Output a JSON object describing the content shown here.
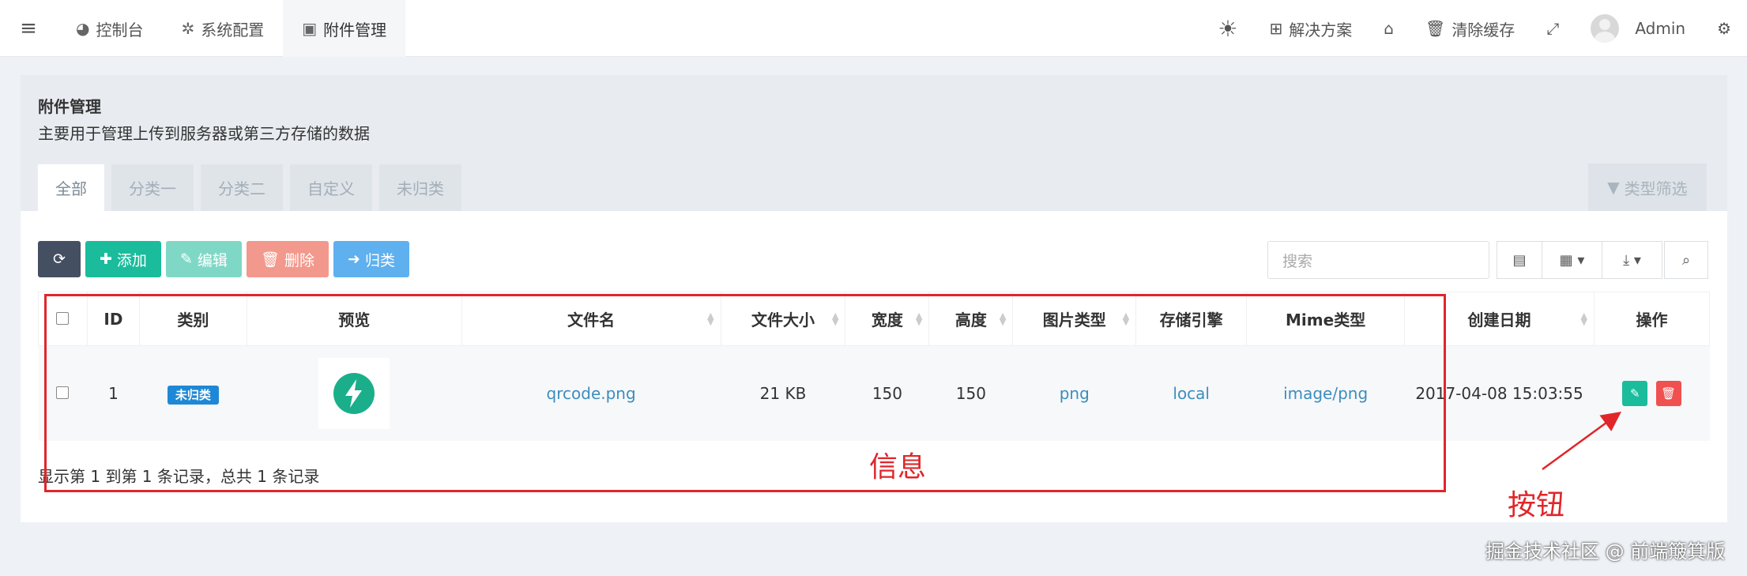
{
  "nav": {
    "items": [
      {
        "label": "控制台",
        "icon": "dashboard-icon"
      },
      {
        "label": "系统配置",
        "icon": "gear-icon"
      },
      {
        "label": "附件管理",
        "icon": "image-icon"
      }
    ],
    "right": {
      "solution": "解决方案",
      "clear_cache": "清除缓存",
      "user": "Admin"
    }
  },
  "panel": {
    "title": "附件管理",
    "description": "主要用于管理上传到服务器或第三方存储的数据",
    "tabs": [
      "全部",
      "分类一",
      "分类二",
      "自定义",
      "未归类"
    ],
    "filter_label": "类型筛选"
  },
  "toolbar": {
    "add": "添加",
    "edit": "编辑",
    "delete": "删除",
    "classify": "归类",
    "search_placeholder": "搜索"
  },
  "table": {
    "columns": [
      "ID",
      "类别",
      "预览",
      "文件名",
      "文件大小",
      "宽度",
      "高度",
      "图片类型",
      "存储引擎",
      "Mime类型",
      "创建日期",
      "操作"
    ],
    "rows": [
      {
        "id": "1",
        "category": "未归类",
        "filename": "qrcode.png",
        "filesize": "21 KB",
        "width": "150",
        "height": "150",
        "imagetype": "png",
        "storage": "local",
        "mime": "image/png",
        "created": "2017-04-08 15:03:55"
      }
    ]
  },
  "pagination_info": "显示第 1 到第 1 条记录，总共 1 条记录",
  "annotations": {
    "info": "信息",
    "buttons": "按钮"
  },
  "watermark": "掘金技术社区 @ 前端簸箕版",
  "colors": {
    "primary": "#1abc9c",
    "danger": "#f05050",
    "info": "#1e88d6",
    "annotation": "#e0262a"
  }
}
